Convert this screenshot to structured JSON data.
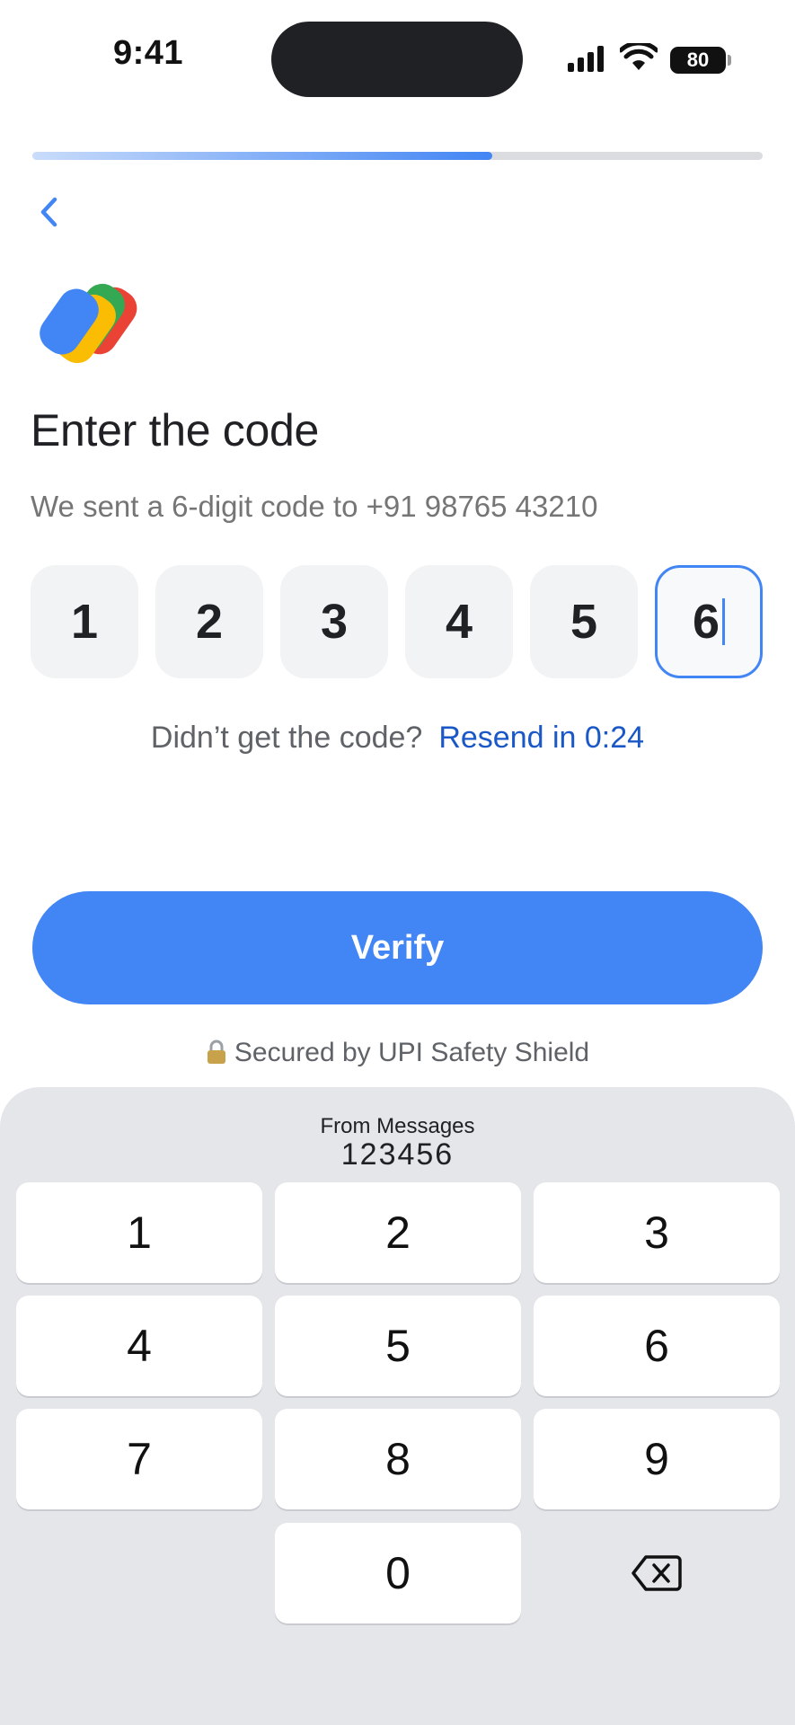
{
  "status_bar": {
    "time": "9:41",
    "battery": "80"
  },
  "progress": {
    "fraction": 0.63
  },
  "header": {
    "title": "Enter the code",
    "subtitle": "We sent a 6-digit code to +91 98765 43210"
  },
  "otp": {
    "digits": [
      "1",
      "2",
      "3",
      "4",
      "5",
      "6"
    ],
    "active_index": 5
  },
  "resend": {
    "question": "Didn’t get the code?",
    "link": "Resend in 0:24"
  },
  "verify_button": {
    "label": "Verify"
  },
  "secured": {
    "text": "Secured by UPI Safety Shield"
  },
  "keyboard": {
    "suggestion_source": "From Messages",
    "suggestion_code": "123456",
    "keys": [
      "1",
      "2",
      "3",
      "4",
      "5",
      "6",
      "7",
      "8",
      "9",
      "0"
    ]
  },
  "colors": {
    "accent": "#4285f4",
    "link": "#1a57c7",
    "keyboard_bg": "#e4e6ea"
  }
}
